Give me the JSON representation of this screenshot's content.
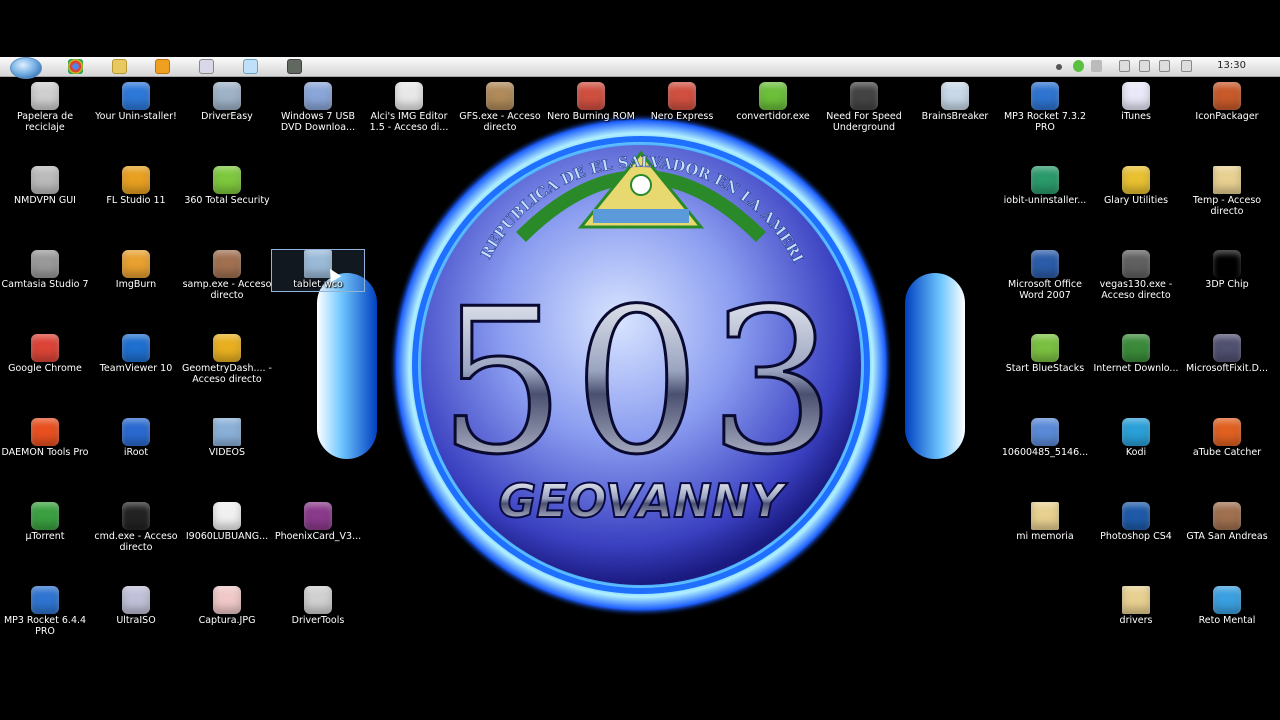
{
  "taskbar": {
    "clock": "13:30",
    "pinned": [
      "start-orb-icon",
      "chrome-icon",
      "explorer-icon",
      "media-icon",
      "notepad-icon",
      "folder-icon",
      "network-tool-icon"
    ]
  },
  "wallpaper": {
    "big_number": "503",
    "name": "GEOVANNY",
    "ring_text": "REPUBLICA DE EL SALVADOR EN LA AMERICA CENTRAL",
    "accent": "#1e90ff",
    "glow": "#58c8ff"
  },
  "icons": [
    {
      "label": "Papelera de reciclaje",
      "name": "recycle-bin-icon",
      "color": "#cfcfcf"
    },
    {
      "label": "Your Unin-staller!",
      "name": "uninstaller-icon",
      "color": "#2d78d8"
    },
    {
      "label": "DriverEasy",
      "name": "drivereasy-icon",
      "color": "#9fb3c8"
    },
    {
      "label": "Windows 7 USB DVD Downloa...",
      "name": "usb-tool-icon",
      "color": "#8aa6d8"
    },
    {
      "label": "Alci's IMG Editor 1.5 - Acceso di...",
      "name": "img-editor-icon",
      "color": "#e8e8e8"
    },
    {
      "label": "GFS.exe - Acceso directo",
      "name": "gfs-icon",
      "color": "#b08a5a"
    },
    {
      "label": "Nero Burning ROM",
      "name": "nero-icon",
      "color": "#d05040"
    },
    {
      "label": "Nero Express",
      "name": "nero-express-icon",
      "color": "#d05040"
    },
    {
      "label": "convertidor.exe",
      "name": "converter-icon",
      "color": "#6bbf3a"
    },
    {
      "label": "Need For Speed Underground",
      "name": "nfs-icon",
      "color": "#444"
    },
    {
      "label": "BrainsBreaker",
      "name": "puzzle-icon",
      "color": "#c8d8e8"
    },
    {
      "label": "MP3 Rocket 7.3.2 PRO",
      "name": "rocket-icon",
      "color": "#2e74d0"
    },
    {
      "label": "iTunes",
      "name": "itunes-icon",
      "color": "#e8e8f8"
    },
    {
      "label": "IconPackager",
      "name": "iconpackager-icon",
      "color": "#c85a2a"
    },
    {
      "label": "NMDVPN GUI",
      "name": "vpn-icon",
      "color": "#bbbbbb"
    },
    {
      "label": "FL Studio 11",
      "name": "flstudio-icon",
      "color": "#e8a020"
    },
    {
      "label": "360 Total Security",
      "name": "security-icon",
      "color": "#7dc83c"
    },
    {
      "label": "iobit-uninstaller...",
      "name": "iobit-icon",
      "color": "#2a9a6a"
    },
    {
      "label": "Glary Utilities",
      "name": "glary-icon",
      "color": "#e8c030"
    },
    {
      "label": "Temp - Acceso directo",
      "name": "temp-folder-icon",
      "color": "#e8d090"
    },
    {
      "label": "Camtasia Studio 7",
      "name": "camtasia-icon",
      "color": "#999"
    },
    {
      "label": "ImgBurn",
      "name": "imgburn-icon",
      "color": "#e8a030"
    },
    {
      "label": "samp.exe - Acceso directo",
      "name": "samp-icon",
      "color": "#a07050"
    },
    {
      "label": "tablet wco",
      "name": "folder-icon",
      "color": "#9bbad8"
    },
    {
      "label": "Microsoft Office Word 2007",
      "name": "word-icon",
      "color": "#2b5ca8"
    },
    {
      "label": "vegas130.exe - Acceso directo",
      "name": "vegas-icon",
      "color": "#606060"
    },
    {
      "label": "3DP Chip",
      "name": "chip-icon",
      "color": "#000"
    },
    {
      "label": "Google Chrome",
      "name": "chrome-icon",
      "color": "#db4437"
    },
    {
      "label": "TeamViewer 10",
      "name": "teamviewer-icon",
      "color": "#1e6fd0"
    },
    {
      "label": "GeometryDash.... - Acceso directo",
      "name": "geometrydash-icon",
      "color": "#e8b020"
    },
    {
      "label": "Start BlueStacks",
      "name": "bluestacks-icon",
      "color": "#7ac040"
    },
    {
      "label": "Internet Downlo...",
      "name": "idm-icon",
      "color": "#3a8a3a"
    },
    {
      "label": "MicrosoftFixit.D...",
      "name": "fixit-icon",
      "color": "#505070"
    },
    {
      "label": "DAEMON Tools Pro",
      "name": "daemon-icon",
      "color": "#e85020"
    },
    {
      "label": "iRoot",
      "name": "iroot-icon",
      "color": "#2a6ad0"
    },
    {
      "label": "VIDEOS",
      "name": "videos-folder-icon",
      "color": "#8ab0d8"
    },
    {
      "label": "10600485_5146...",
      "name": "image-file-icon",
      "color": "#5a8ad8"
    },
    {
      "label": "Kodi",
      "name": "kodi-icon",
      "color": "#2aa0d8"
    },
    {
      "label": "aTube Catcher",
      "name": "atube-icon",
      "color": "#e06020"
    },
    {
      "label": "µTorrent",
      "name": "utorrent-icon",
      "color": "#3aa040"
    },
    {
      "label": "cmd.exe - Acceso directo",
      "name": "cmd-icon",
      "color": "#222"
    },
    {
      "label": "I9060LUBUANG...",
      "name": "file-icon",
      "color": "#f0f0f0"
    },
    {
      "label": "PhoenixCard_V3...",
      "name": "winrar-icon",
      "color": "#8a3a8a"
    },
    {
      "label": "mi memoria",
      "name": "mi-memoria-folder-icon",
      "color": "#e8d090"
    },
    {
      "label": "Photoshop CS4",
      "name": "photoshop-icon",
      "color": "#1e5aa8"
    },
    {
      "label": "GTA San Andreas",
      "name": "gta-icon",
      "color": "#a07050"
    },
    {
      "label": "MP3 Rocket 6.4.4 PRO",
      "name": "rocket-old-icon",
      "color": "#2e74d0"
    },
    {
      "label": "UltraISO",
      "name": "ultraiso-icon",
      "color": "#c0c0d8"
    },
    {
      "label": "Captura.JPG",
      "name": "jpg-file-icon",
      "color": "#f0c8c8"
    },
    {
      "label": "DriverTools",
      "name": "drivertools-icon",
      "color": "#d0d0d0"
    },
    {
      "label": "drivers",
      "name": "drivers-folder-icon",
      "color": "#e8d090"
    },
    {
      "label": "Reto Mental",
      "name": "reto-mental-icon",
      "color": "#3aa0e0"
    }
  ]
}
